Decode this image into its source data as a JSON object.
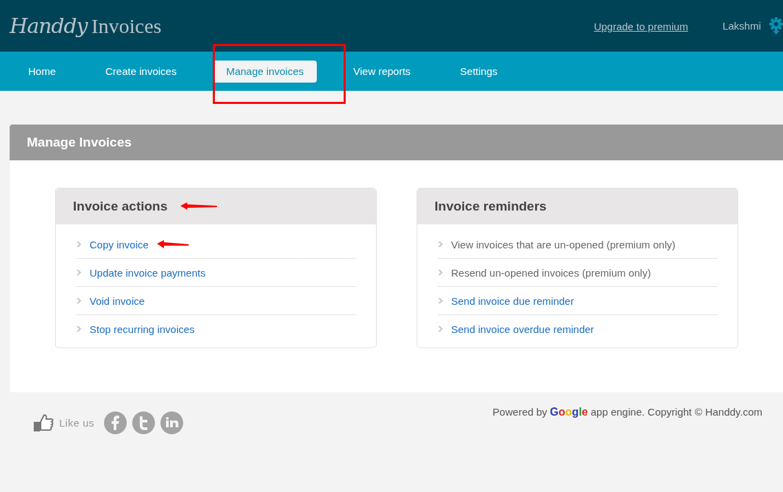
{
  "header": {
    "logo_script": "Handdy",
    "logo_text": "Invoices",
    "upgrade_link": "Upgrade to premium",
    "user_name": "Lakshmi"
  },
  "nav": [
    {
      "label": "Home",
      "selected": false
    },
    {
      "label": "Create invoices",
      "selected": false
    },
    {
      "label": "Manage invoices",
      "selected": true
    },
    {
      "label": "View reports",
      "selected": false
    },
    {
      "label": "Settings",
      "selected": false
    }
  ],
  "panel": {
    "title": "Manage Invoices",
    "cards": [
      {
        "title": "Invoice actions",
        "items": [
          {
            "label": "Copy invoice",
            "disabled": false
          },
          {
            "label": "Update invoice payments",
            "disabled": false
          },
          {
            "label": "Void invoice",
            "disabled": false
          },
          {
            "label": "Stop recurring invoices",
            "disabled": false
          }
        ]
      },
      {
        "title": "Invoice reminders",
        "items": [
          {
            "label": "View invoices that are un-opened (premium only)",
            "disabled": true
          },
          {
            "label": "Resend un-opened invoices (premium only)",
            "disabled": true
          },
          {
            "label": "Send invoice due reminder",
            "disabled": false
          },
          {
            "label": "Send invoice overdue reminder",
            "disabled": false
          }
        ]
      }
    ]
  },
  "footer": {
    "like_label": "Like us",
    "powered_prefix": "Powered by",
    "powered_logo": "Google",
    "powered_suffix": "app engine. Copyright © Handdy.com"
  }
}
